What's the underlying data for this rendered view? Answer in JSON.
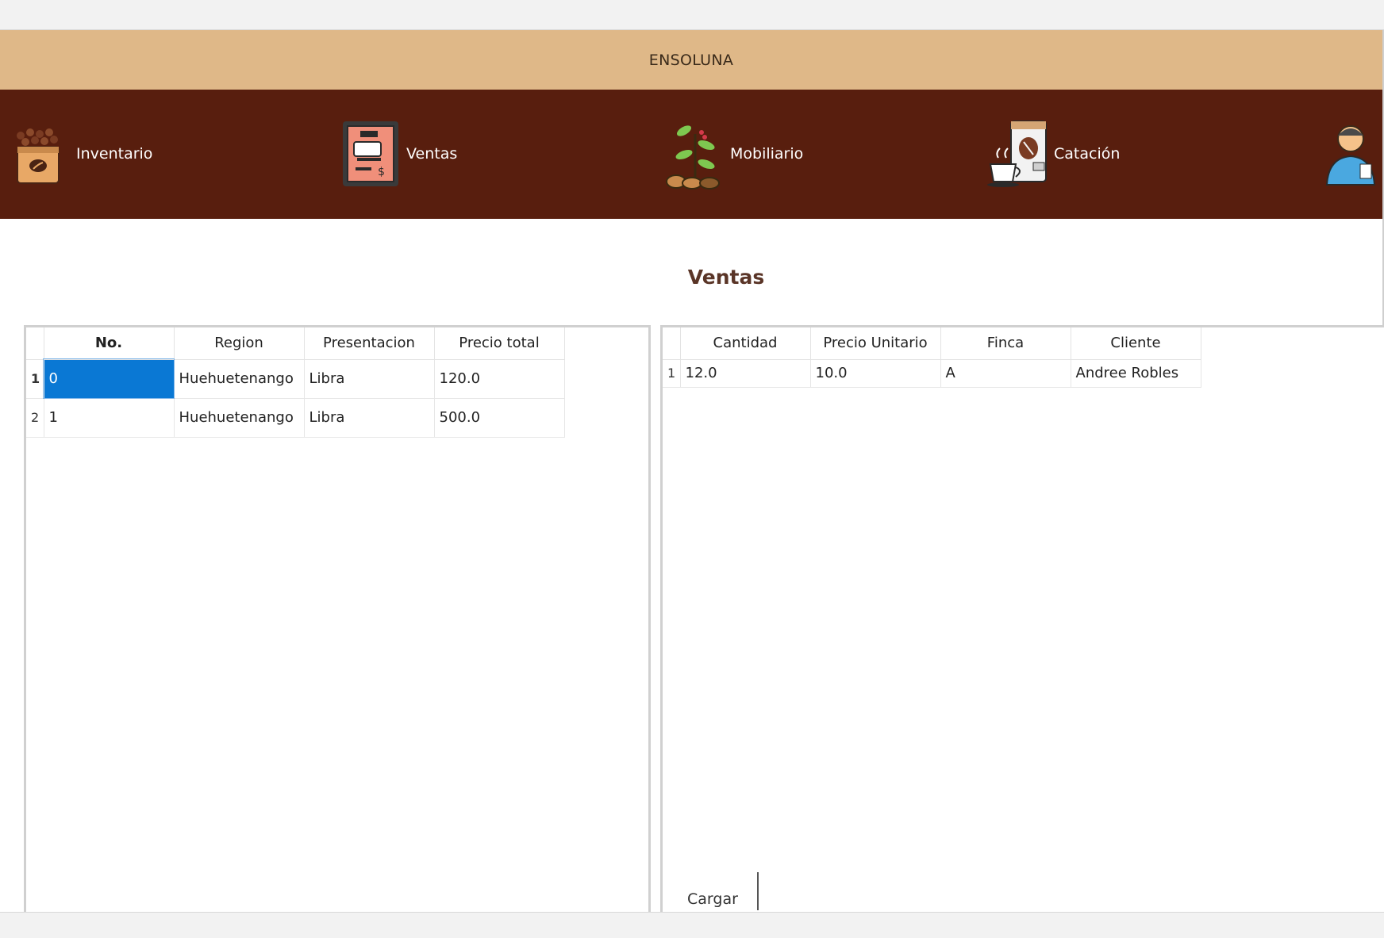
{
  "app": {
    "title": "ENSOLUNA"
  },
  "nav": {
    "items": [
      {
        "label": "Inventario",
        "icon": "coffee-sack-icon"
      },
      {
        "label": "Ventas",
        "icon": "sales-sign-icon"
      },
      {
        "label": "Mobiliario",
        "icon": "coffee-plant-icon"
      },
      {
        "label": "Catación",
        "icon": "coffee-cup-icon"
      },
      {
        "label": "",
        "icon": "user-avatar-icon"
      }
    ]
  },
  "page": {
    "heading": "Ventas"
  },
  "ventas_table": {
    "columns": [
      "No.",
      "Region",
      "Presentacion",
      "Precio total"
    ],
    "rows": [
      {
        "num": "1",
        "cells": [
          "0",
          "Huehuetenango",
          "Libra",
          "120.0"
        ]
      },
      {
        "num": "2",
        "cells": [
          "1",
          "Huehuetenango",
          "Libra",
          "500.0"
        ]
      }
    ]
  },
  "detalle_table": {
    "columns": [
      "Cantidad",
      "Precio Unitario",
      "Finca",
      "Cliente"
    ],
    "rows": [
      {
        "num": "1",
        "cells": [
          "12.0",
          "10.0",
          "A",
          "Andree Robles"
        ]
      }
    ]
  },
  "actions": {
    "cargar_label": "Cargar"
  },
  "colors": {
    "title_bar": "#dfb888",
    "nav_bar": "#581e0e",
    "selection": "#0a78d4"
  }
}
